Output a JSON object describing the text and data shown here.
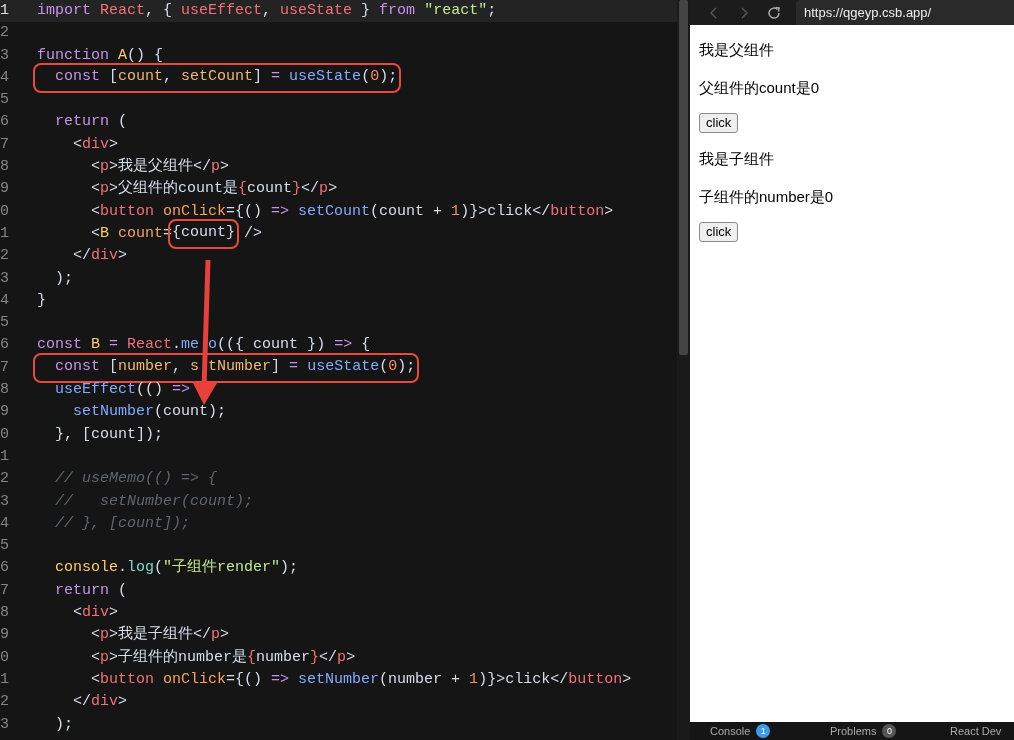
{
  "editor": {
    "lines": [
      {
        "number": "1",
        "current": true,
        "boxed": false,
        "tokens": [
          {
            "kind": "kw",
            "text": "import"
          },
          {
            "kind": "name",
            "text": " React"
          },
          {
            "kind": "plain",
            "text": ", { "
          },
          {
            "kind": "name",
            "text": "useEffect"
          },
          {
            "kind": "plain",
            "text": ", "
          },
          {
            "kind": "name",
            "text": "useState"
          },
          {
            "kind": "plain",
            "text": " } "
          },
          {
            "kind": "kw",
            "text": "from"
          },
          {
            "kind": "str",
            "text": " \"react\""
          },
          {
            "kind": "plain",
            "text": ";"
          }
        ]
      },
      {
        "number": "2",
        "current": false,
        "boxed": false
      },
      {
        "number": "3",
        "current": false,
        "boxed": false,
        "tokens": [
          {
            "kind": "kw",
            "text": "function"
          },
          {
            "kind": "fn",
            "text": " A"
          },
          {
            "kind": "plain",
            "text": "() {"
          }
        ]
      },
      {
        "number": "4",
        "current": false,
        "boxed": true,
        "tokens": [
          {
            "kind": "kw",
            "text": "  const"
          },
          {
            "kind": "plain",
            "text": " ["
          },
          {
            "kind": "var",
            "text": "count"
          },
          {
            "kind": "plain",
            "text": ", "
          },
          {
            "kind": "var",
            "text": "setCount"
          },
          {
            "kind": "plain",
            "text": "] "
          },
          {
            "kind": "op",
            "text": "="
          },
          {
            "kind": "call",
            "text": " useState"
          },
          {
            "kind": "plain",
            "text": "("
          },
          {
            "kind": "num",
            "text": "0"
          },
          {
            "kind": "plain",
            "text": ");"
          }
        ]
      },
      {
        "number": "5",
        "current": false,
        "boxed": false
      },
      {
        "number": "6",
        "current": false,
        "boxed": false,
        "tokens": [
          {
            "kind": "kw",
            "text": "  return"
          },
          {
            "kind": "plain",
            "text": " ("
          }
        ]
      },
      {
        "number": "7",
        "current": false,
        "boxed": false,
        "tokens": [
          {
            "kind": "plain",
            "text": "    <"
          },
          {
            "kind": "tag",
            "text": "div"
          },
          {
            "kind": "plain",
            "text": ">"
          }
        ]
      },
      {
        "number": "8",
        "current": false,
        "boxed": false,
        "tokens": [
          {
            "kind": "plain",
            "text": "      <"
          },
          {
            "kind": "tag",
            "text": "p"
          },
          {
            "kind": "plain",
            "text": ">我是父组件</"
          },
          {
            "kind": "tag",
            "text": "p"
          },
          {
            "kind": "plain",
            "text": ">"
          }
        ]
      },
      {
        "number": "9",
        "current": false,
        "boxed": false,
        "tokens": [
          {
            "kind": "plain",
            "text": "      <"
          },
          {
            "kind": "tag",
            "text": "p"
          },
          {
            "kind": "plain",
            "text": ">父组件的count是"
          },
          {
            "kind": "tag",
            "text": "{"
          },
          {
            "kind": "plain",
            "text": "count"
          },
          {
            "kind": "tag",
            "text": "}"
          },
          {
            "kind": "plain",
            "text": "</"
          },
          {
            "kind": "tag",
            "text": "p"
          },
          {
            "kind": "plain",
            "text": ">"
          }
        ]
      },
      {
        "number": "0",
        "current": false,
        "boxed": false,
        "tokens": [
          {
            "kind": "plain",
            "text": "      <"
          },
          {
            "kind": "tag",
            "text": "button"
          },
          {
            "kind": "attr",
            "text": " onClick"
          },
          {
            "kind": "plain",
            "text": "={() "
          },
          {
            "kind": "op",
            "text": "=>"
          },
          {
            "kind": "call",
            "text": " setCount"
          },
          {
            "kind": "plain",
            "text": "(count + "
          },
          {
            "kind": "num",
            "text": "1"
          },
          {
            "kind": "plain",
            "text": ")}>click</"
          },
          {
            "kind": "tag",
            "text": "button"
          },
          {
            "kind": "plain",
            "text": ">"
          }
        ]
      },
      {
        "number": "1",
        "current": false,
        "boxed": false,
        "tokens": [
          {
            "kind": "plain",
            "text": "      <"
          },
          {
            "kind": "fn",
            "text": "B"
          },
          {
            "kind": "attr",
            "text": " count"
          },
          {
            "kind": "plain",
            "text": "="
          },
          {
            "kind": "boxed",
            "text": "{count}"
          },
          {
            "kind": "plain",
            "text": " />"
          }
        ]
      },
      {
        "number": "2",
        "current": false,
        "boxed": false,
        "tokens": [
          {
            "kind": "plain",
            "text": "    </"
          },
          {
            "kind": "tag",
            "text": "div"
          },
          {
            "kind": "plain",
            "text": ">"
          }
        ]
      },
      {
        "number": "3",
        "current": false,
        "boxed": false,
        "tokens": [
          {
            "kind": "plain",
            "text": "  );"
          }
        ]
      },
      {
        "number": "4",
        "current": false,
        "boxed": false,
        "tokens": [
          {
            "kind": "plain",
            "text": "}"
          }
        ]
      },
      {
        "number": "5",
        "current": false,
        "boxed": false
      },
      {
        "number": "6",
        "current": false,
        "boxed": false,
        "tokens": [
          {
            "kind": "kw",
            "text": "const"
          },
          {
            "kind": "fn",
            "text": " B"
          },
          {
            "kind": "op",
            "text": " ="
          },
          {
            "kind": "name",
            "text": " React"
          },
          {
            "kind": "plain",
            "text": "."
          },
          {
            "kind": "call",
            "text": "me"
          },
          {
            "kind": "call_after_gap",
            "text": "o"
          },
          {
            "kind": "plain",
            "text": "(({ count }) "
          },
          {
            "kind": "op",
            "text": "=>"
          },
          {
            "kind": "plain",
            "text": " {"
          }
        ]
      },
      {
        "number": "7",
        "current": false,
        "boxed": true,
        "tokens": [
          {
            "kind": "kw",
            "text": "  const"
          },
          {
            "kind": "plain",
            "text": " ["
          },
          {
            "kind": "var",
            "text": "number"
          },
          {
            "kind": "plain",
            "text": ", "
          },
          {
            "kind": "var",
            "text": "s"
          },
          {
            "kind": "var_after_gap",
            "text": "tNumber"
          },
          {
            "kind": "plain",
            "text": "] "
          },
          {
            "kind": "op",
            "text": "="
          },
          {
            "kind": "call",
            "text": " useState"
          },
          {
            "kind": "plain",
            "text": "("
          },
          {
            "kind": "num",
            "text": "0"
          },
          {
            "kind": "plain",
            "text": ");"
          }
        ]
      },
      {
        "number": "8",
        "current": false,
        "boxed": false,
        "tokens": [
          {
            "kind": "call",
            "text": "  useEffect"
          },
          {
            "kind": "plain",
            "text": "(() "
          },
          {
            "kind": "op",
            "text": "=>"
          }
        ]
      },
      {
        "number": "9",
        "current": false,
        "boxed": false,
        "tokens": [
          {
            "kind": "call",
            "text": "    setNumber"
          },
          {
            "kind": "plain",
            "text": "(count);"
          }
        ]
      },
      {
        "number": "0",
        "current": false,
        "boxed": false,
        "tokens": [
          {
            "kind": "plain",
            "text": "  }, [count]);"
          }
        ]
      },
      {
        "number": "1",
        "current": false,
        "boxed": false
      },
      {
        "number": "2",
        "current": false,
        "boxed": false,
        "tokens": [
          {
            "kind": "comment",
            "text": "  // useMemo(() => {"
          }
        ]
      },
      {
        "number": "3",
        "current": false,
        "boxed": false,
        "tokens": [
          {
            "kind": "comment",
            "text": "  //   setNumber(count);"
          }
        ]
      },
      {
        "number": "4",
        "current": false,
        "boxed": false,
        "tokens": [
          {
            "kind": "comment",
            "text": "  // }, [count]);"
          }
        ]
      },
      {
        "number": "5",
        "current": false,
        "boxed": false
      },
      {
        "number": "6",
        "current": false,
        "boxed": false,
        "tokens": [
          {
            "kind": "obj",
            "text": "  console"
          },
          {
            "kind": "plain",
            "text": "."
          },
          {
            "kind": "method",
            "text": "log"
          },
          {
            "kind": "plain",
            "text": "("
          },
          {
            "kind": "str",
            "text": "\"子组件render\""
          },
          {
            "kind": "plain",
            "text": ");"
          }
        ]
      },
      {
        "number": "7",
        "current": false,
        "boxed": false,
        "tokens": [
          {
            "kind": "kw",
            "text": "  return"
          },
          {
            "kind": "plain",
            "text": " ("
          }
        ]
      },
      {
        "number": "8",
        "current": false,
        "boxed": false,
        "tokens": [
          {
            "kind": "plain",
            "text": "    <"
          },
          {
            "kind": "tag",
            "text": "div"
          },
          {
            "kind": "plain",
            "text": ">"
          }
        ]
      },
      {
        "number": "9",
        "current": false,
        "boxed": false,
        "tokens": [
          {
            "kind": "plain",
            "text": "      <"
          },
          {
            "kind": "tag",
            "text": "p"
          },
          {
            "kind": "plain",
            "text": ">我是子组件</"
          },
          {
            "kind": "tag",
            "text": "p"
          },
          {
            "kind": "plain",
            "text": ">"
          }
        ]
      },
      {
        "number": "0",
        "current": false,
        "boxed": false,
        "tokens": [
          {
            "kind": "plain",
            "text": "      <"
          },
          {
            "kind": "tag",
            "text": "p"
          },
          {
            "kind": "plain",
            "text": ">子组件的number是"
          },
          {
            "kind": "tag",
            "text": "{"
          },
          {
            "kind": "plain",
            "text": "number"
          },
          {
            "kind": "tag",
            "text": "}"
          },
          {
            "kind": "plain",
            "text": "</"
          },
          {
            "kind": "tag",
            "text": "p"
          },
          {
            "kind": "plain",
            "text": ">"
          }
        ]
      },
      {
        "number": "1",
        "current": false,
        "boxed": false,
        "tokens": [
          {
            "kind": "plain",
            "text": "      <"
          },
          {
            "kind": "tag",
            "text": "button"
          },
          {
            "kind": "attr",
            "text": " onClick"
          },
          {
            "kind": "plain",
            "text": "={() "
          },
          {
            "kind": "op",
            "text": "=>"
          },
          {
            "kind": "call",
            "text": " setNumber"
          },
          {
            "kind": "plain",
            "text": "(number + "
          },
          {
            "kind": "num",
            "text": "1"
          },
          {
            "kind": "plain",
            "text": ")}>click</"
          },
          {
            "kind": "tag",
            "text": "button"
          },
          {
            "kind": "plain",
            "text": ">"
          }
        ]
      },
      {
        "number": "2",
        "current": false,
        "boxed": false,
        "tokens": [
          {
            "kind": "plain",
            "text": "    </"
          },
          {
            "kind": "tag",
            "text": "div"
          },
          {
            "kind": "plain",
            "text": ">"
          }
        ]
      },
      {
        "number": "3",
        "current": false,
        "boxed": false,
        "tokens": [
          {
            "kind": "plain",
            "text": "  );"
          }
        ]
      }
    ]
  },
  "browser": {
    "url": "https://qgeyp.csb.app/",
    "content": [
      {
        "kind": "paragraph",
        "text": "我是父组件"
      },
      {
        "kind": "paragraph",
        "text": "父组件的count是0"
      },
      {
        "kind": "button",
        "text": "click"
      },
      {
        "kind": "paragraph",
        "text": "我是子组件"
      },
      {
        "kind": "paragraph",
        "text": "子组件的number是0"
      },
      {
        "kind": "button",
        "text": "click"
      }
    ]
  },
  "bottom_tabs": [
    {
      "label": "Console",
      "badge": "1",
      "color": "#3d9be9"
    },
    {
      "label": "Problems",
      "badge": "0",
      "color": "#555555"
    },
    {
      "label": "React Dev"
    }
  ]
}
